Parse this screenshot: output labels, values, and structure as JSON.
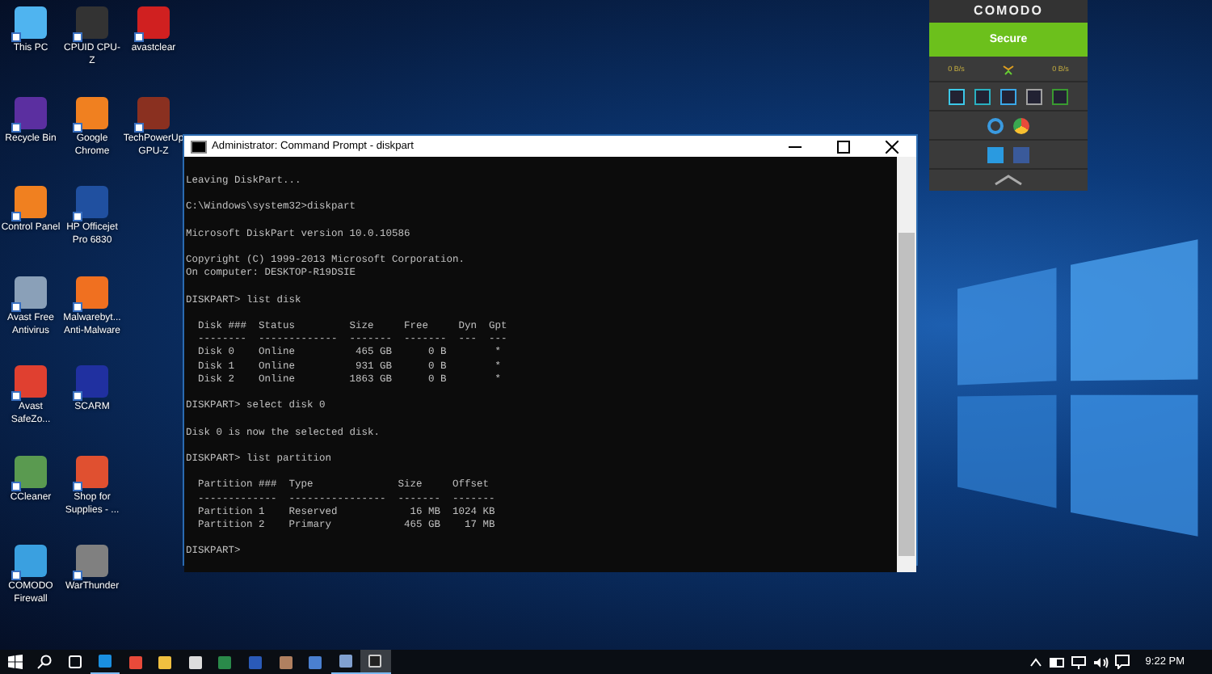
{
  "desktop_columns": [
    [
      {
        "label": "This PC"
      },
      {
        "label": "Recycle Bin"
      },
      {
        "label": "Control Panel"
      },
      {
        "label": "Avast Free Antivirus"
      },
      {
        "label": "Avast SafeZo..."
      },
      {
        "label": "CCleaner"
      },
      {
        "label": "COMODO Firewall"
      }
    ],
    [
      {
        "label": "CPUID CPU-Z"
      },
      {
        "label": "Google Chrome"
      },
      {
        "label": "HP Officejet Pro 6830"
      },
      {
        "label": "Malwarebyt... Anti-Malware"
      },
      {
        "label": "SCARM"
      },
      {
        "label": "Shop for Supplies - ..."
      },
      {
        "label": "WarThunder"
      }
    ],
    [
      {
        "label": "avastclear"
      },
      {
        "label": "TechPowerUp GPU-Z"
      }
    ]
  ],
  "window": {
    "title": "Administrator: Command Prompt - diskpart",
    "console_blocks": [
      [
        "Leaving DiskPart..."
      ],
      [
        "C:\\Windows\\system32>diskpart"
      ],
      [
        "Microsoft DiskPart version 10.0.10586"
      ],
      [
        "Copyright (C) 1999-2013 Microsoft Corporation.",
        "On computer: DESKTOP-R19DSIE"
      ],
      [
        "DISKPART> list disk"
      ],
      [
        "  Disk ###  Status         Size     Free     Dyn  Gpt",
        "  --------  -------------  -------  -------  ---  ---",
        "  Disk 0    Online          465 GB      0 B        *",
        "  Disk 1    Online          931 GB      0 B        *",
        "  Disk 2    Online         1863 GB      0 B        *"
      ],
      [
        "DISKPART> select disk 0"
      ],
      [
        "Disk 0 is now the selected disk."
      ],
      [
        "DISKPART> list partition"
      ],
      [
        "  Partition ###  Type              Size     Offset",
        "  -------------  ----------------  -------  -------",
        "  Partition 1    Reserved            16 MB  1024 KB",
        "  Partition 2    Primary            465 GB    17 MB"
      ],
      [
        "DISKPART> "
      ]
    ]
  },
  "comodo_widget": {
    "brand": "COMODO",
    "status": "Secure",
    "download_speed": "0 B/s",
    "upload_speed": "0 B/s"
  },
  "taskbar": {
    "apps": [
      {
        "kind": "edge",
        "running": true,
        "active": false
      },
      {
        "kind": "chrome",
        "running": false,
        "active": false
      },
      {
        "kind": "explorer",
        "running": false,
        "active": false
      },
      {
        "kind": "store",
        "running": false,
        "active": false
      },
      {
        "kind": "excel",
        "running": false,
        "active": false
      },
      {
        "kind": "word",
        "running": false,
        "active": false
      },
      {
        "kind": "game",
        "running": false,
        "active": false
      },
      {
        "kind": "globe",
        "running": false,
        "active": false
      },
      {
        "kind": "network",
        "running": true,
        "active": false
      },
      {
        "kind": "console",
        "running": true,
        "active": true
      }
    ],
    "clock": "9:22 PM"
  }
}
